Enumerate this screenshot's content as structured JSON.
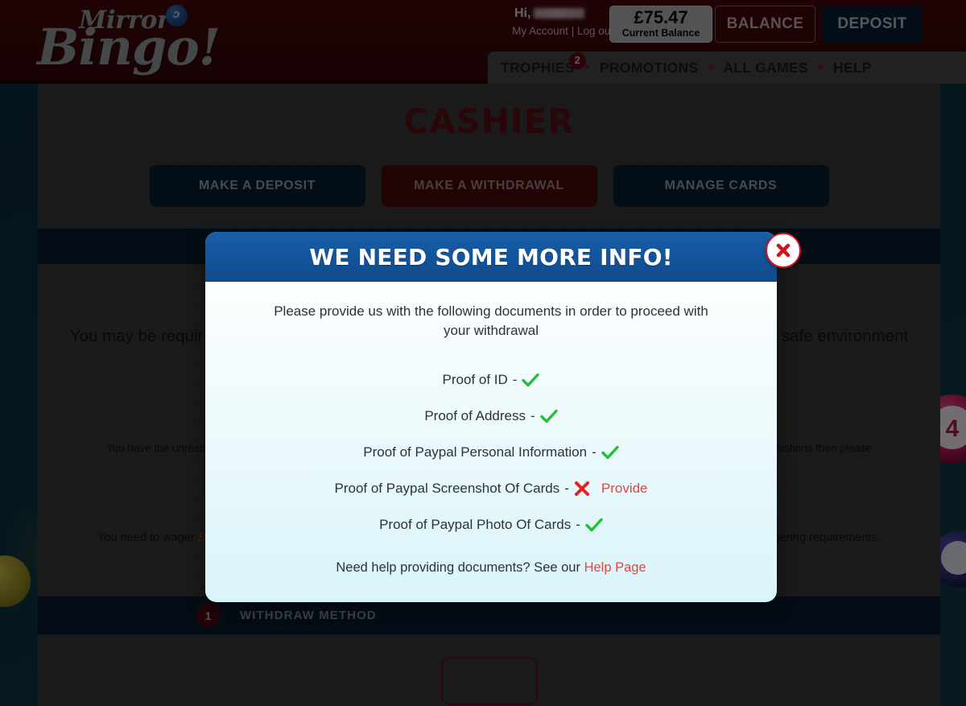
{
  "header": {
    "logo": {
      "mirror": "Mirror",
      "bingo": "Bingo!",
      "dot_glyph": "ɔ"
    },
    "greeting_prefix": "Hi,",
    "account_links": "My Account | Log out",
    "balance_amount": "£75.47",
    "balance_label": "Current Balance",
    "balance_button": "BALANCE",
    "deposit_button": "DEPOSIT",
    "nav": {
      "trophies": "TROPHIES",
      "trophies_badge": "2",
      "promotions": "PROMOTIONS",
      "all_games": "ALL GAMES",
      "help": "HELP",
      "separator": "•"
    }
  },
  "page": {
    "title": "CASHIER",
    "tabs": [
      {
        "label": "MAKE A DEPOSIT",
        "active": false
      },
      {
        "label": "MAKE A WITHDRAWAL",
        "active": true
      },
      {
        "label": "MANAGE CARDS",
        "active": false
      }
    ],
    "body_copy": "You may be required to provide documents. We may request these at any time to ensure this is a safe environment and to protect your information.",
    "fine_copy": "You have the unrestricted right to withdraw your funds, subject to our terms and fulfilling additional verification checks. If you do have any questions then please contact our customer support team",
    "wager_copy_before": "You need to wager ",
    "wager_amount": "£0.00",
    "wager_copy_after": " before you can withdraw. Your bonus balance will be reset to £0 if you withdraw before completing the wagering requirements.",
    "step": {
      "number": "1",
      "label": "WITHDRAW METHOD"
    }
  },
  "decor": {
    "ball_number": "4"
  },
  "modal": {
    "title": "WE NEED SOME MORE INFO!",
    "close_icon": "close-icon",
    "intro": "Please provide us with the following documents in order to proceed with your withdrawal",
    "dash": "-",
    "documents": [
      {
        "label": "Proof of ID",
        "status": "approved",
        "action": ""
      },
      {
        "label": "Proof of Address",
        "status": "approved",
        "action": ""
      },
      {
        "label": "Proof of Paypal Personal Information",
        "status": "approved",
        "action": ""
      },
      {
        "label": "Proof of Paypal Screenshot Of Cards",
        "status": "missing",
        "action": "Provide"
      },
      {
        "label": "Proof of Paypal Photo Of Cards",
        "status": "approved",
        "action": ""
      }
    ],
    "footer_text": "Need help providing documents? See our ",
    "footer_link": "Help Page"
  },
  "colors": {
    "brand_red": "#4c0a0d",
    "header_blue": "#14559c",
    "check_green": "#22c03a",
    "cross_red": "#e8201f",
    "link_red": "#e8453c",
    "dark_navy": "#0a1e31"
  }
}
